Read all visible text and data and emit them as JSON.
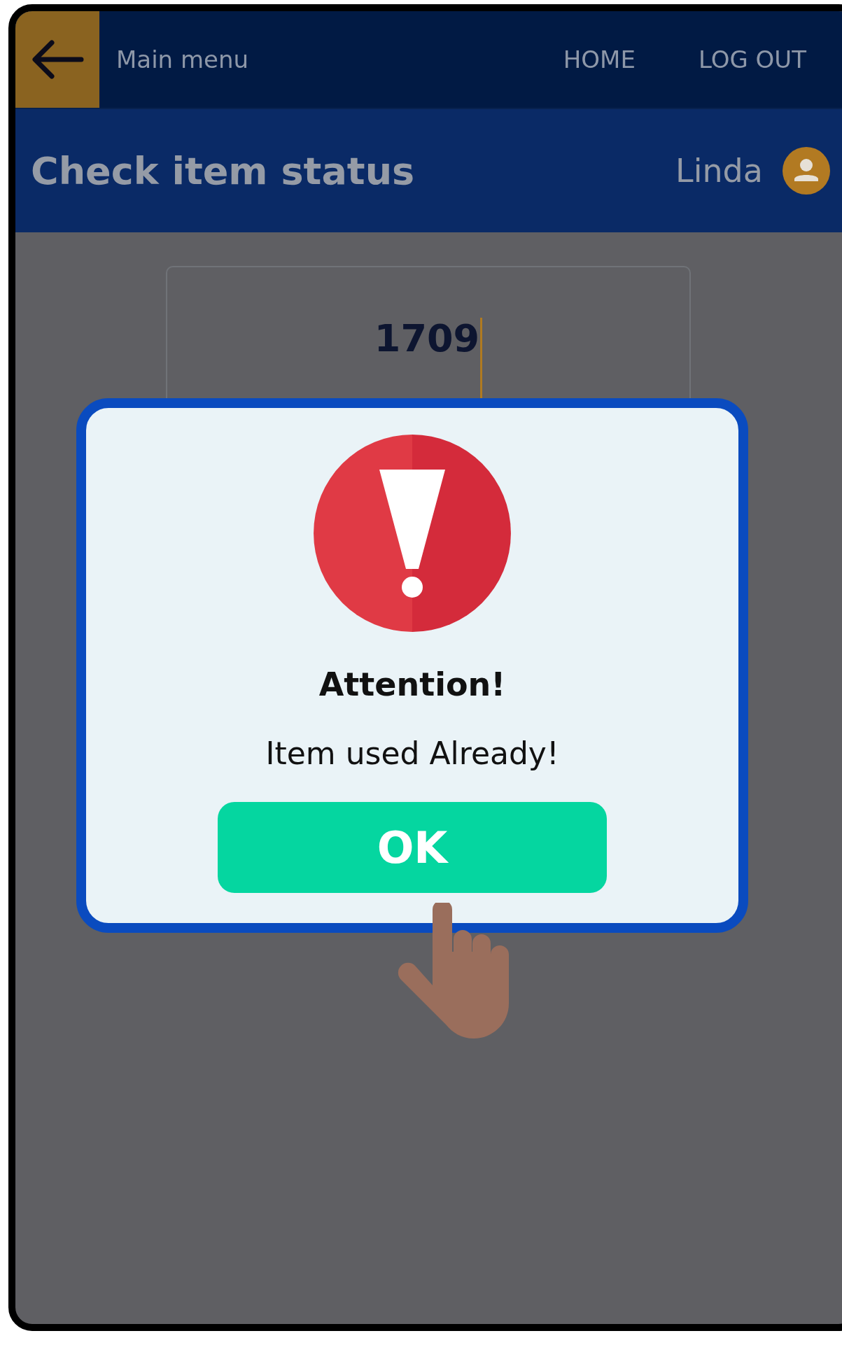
{
  "nav": {
    "menu_label": "Main menu",
    "links": [
      "HOME",
      "LOG OUT"
    ]
  },
  "header": {
    "title": "Check item status",
    "user": "Linda"
  },
  "item_field": {
    "value": "1709"
  },
  "dialog": {
    "title": "Attention!",
    "message": "Item used Already!",
    "button": "OK"
  }
}
